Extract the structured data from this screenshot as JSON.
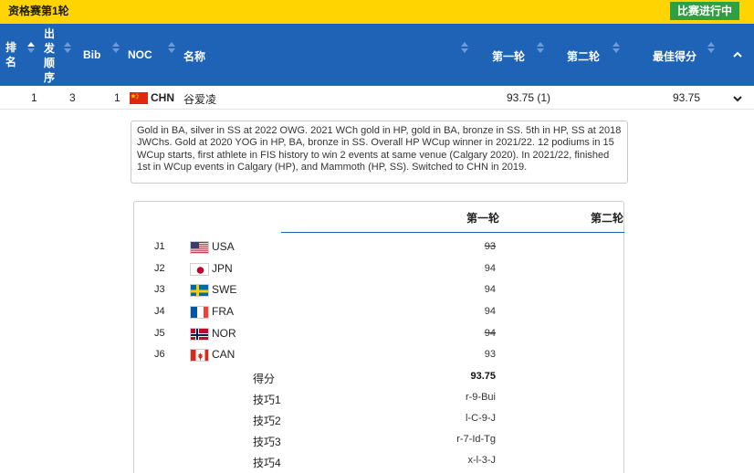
{
  "banner": {
    "round_title": "资格赛第1轮",
    "status_badge": "比赛进行中"
  },
  "table_header": {
    "rank": "排名",
    "start_order": "出发顺序",
    "bib": "Bib",
    "noc": "NOC",
    "name": "名称",
    "run1": "第一轮",
    "run2": "第二轮",
    "best": "最佳得分"
  },
  "athlete": {
    "rank": "1",
    "start_order": "3",
    "bib": "1",
    "noc": "CHN",
    "name": "谷爱凌",
    "run1": "93.75 (1)",
    "run2": "",
    "best": "93.75",
    "bio": "Gold in BA, silver in SS at 2022 OWG. 2021 WCh gold in HP, gold in BA, bronze in SS. 5th in HP, SS at 2018 JWChs. Gold at 2020 YOG in HP, BA, bronze in SS. Overall HP WCup winner in 2021/22. 12 podiums in 15 WCup starts, first athlete in FIS history to win 2 events at same venue (Calgary 2020). In 2021/22, finished 1st in WCup events in Calgary (HP), and Mammoth (HP, SS). Switched to CHN in 2019."
  },
  "judges_table": {
    "run1_header": "第一轮",
    "run2_header": "第二轮",
    "judges": [
      {
        "id": "J1",
        "noc": "USA",
        "score": "93",
        "struck": true
      },
      {
        "id": "J2",
        "noc": "JPN",
        "score": "94",
        "struck": false
      },
      {
        "id": "J3",
        "noc": "SWE",
        "score": "94",
        "struck": false
      },
      {
        "id": "J4",
        "noc": "FRA",
        "score": "94",
        "struck": false
      },
      {
        "id": "J5",
        "noc": "NOR",
        "score": "94",
        "struck": true
      },
      {
        "id": "J6",
        "noc": "CAN",
        "score": "93",
        "struck": false
      }
    ],
    "score_label": "得分",
    "score_value": "93.75",
    "tricks": [
      {
        "label": "技巧1",
        "value": "r-9-Bui"
      },
      {
        "label": "技巧2",
        "value": "l-C-9-J"
      },
      {
        "label": "技巧3",
        "value": "r-7-Id-Tg"
      },
      {
        "label": "技巧4",
        "value": "x-l-3-J"
      }
    ]
  },
  "colors": {
    "banner": "#ffd400",
    "header": "#1e63b5",
    "live_badge": "#2ea043"
  }
}
